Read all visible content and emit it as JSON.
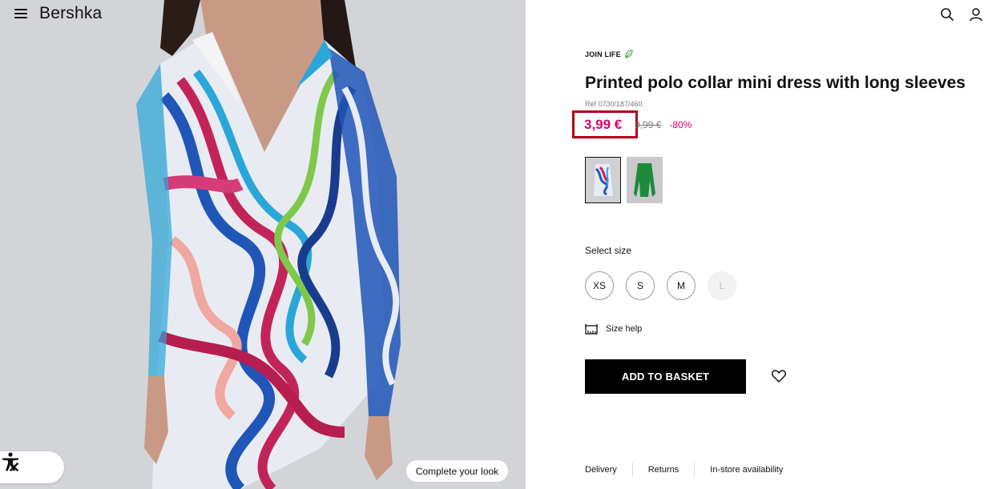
{
  "header": {
    "logo": "Bershka",
    "menu_icon": "hamburger-menu-icon",
    "search_icon": "search-icon",
    "account_icon": "user-icon"
  },
  "product": {
    "collection": "JOIN LIFE",
    "title": "Printed polo collar mini dress with long sleeves",
    "ref": "Ref 0730/187/460",
    "price_current": "3,99 €",
    "price_old": "9,99 €",
    "discount": "-80%",
    "colors": [
      "multicolor print",
      "green"
    ],
    "size_label": "Select size",
    "sizes": [
      "XS",
      "S",
      "M",
      "L"
    ],
    "size_help": "Size help",
    "add_to_basket": "ADD TO BASKET"
  },
  "footer_links": [
    "Delivery",
    "Returns",
    "In-store availability"
  ],
  "image_overlay": {
    "complete_look": "Complete your look",
    "close_glyph": "✕"
  },
  "colors": {
    "sale": "#d6006b",
    "highlight_box": "#b00018",
    "button_bg": "#000000",
    "image_bg": "#d3d4d8"
  }
}
